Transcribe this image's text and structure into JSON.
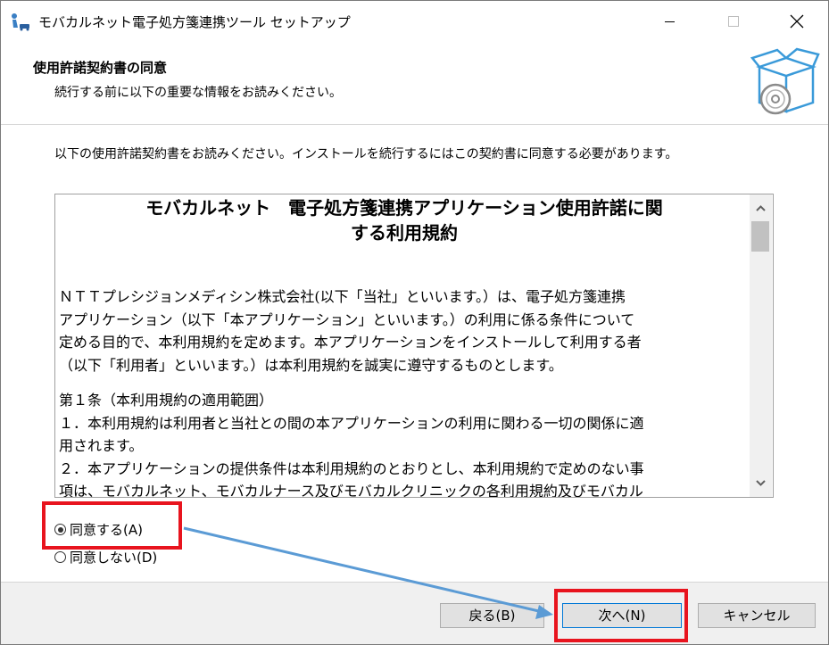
{
  "window": {
    "title": "モバカルネット電子処方箋連携ツール セットアップ"
  },
  "header": {
    "title": "使用許諾契約書の同意",
    "subtitle": "続行する前に以下の重要な情報をお読みください。"
  },
  "instruction": "以下の使用許諾契約書をお読みください。インストールを続行するにはこの契約書に同意する必要があります。",
  "license": {
    "title_line1": "モバカルネット　電子処方箋連携アプリケーション使用許諾に関",
    "title_line2": "する利用規約",
    "para1": [
      "ＮＴＴプレシジョンメディシン株式会社(以下「当社」といいます。）は、電子処方箋連携",
      "アプリケーション（以下「本アプリケーション」といいます。）の利用に係る条件について",
      "定める目的で、本利用規約を定めます。本アプリケーションをインストールして利用する者",
      "（以下「利用者」といいます。）は本利用規約を誠実に遵守するものとします。"
    ],
    "article1_heading": "第１条（本利用規約の適用範囲）",
    "article1": [
      "１．本利用規約は利用者と当社との間の本アプリケーションの利用に関わる一切の関係に適",
      "用されます。",
      "２．本アプリケーションの提供条件は本利用規約のとおりとし、本利用規約で定めのない事",
      "項は、モバカルネット、モバカルナース及びモバカルクリニックの各利用規約及びモバカル"
    ]
  },
  "radios": {
    "agree": "同意する(A)",
    "disagree": "同意しない(D)",
    "selected": "agree"
  },
  "buttons": {
    "back": "戻る(B)",
    "next": "次へ(N)",
    "cancel": "キャンセル"
  },
  "colors": {
    "highlight": "#e8141e",
    "arrow": "#5b9bd5",
    "focus": "#0078d7"
  }
}
